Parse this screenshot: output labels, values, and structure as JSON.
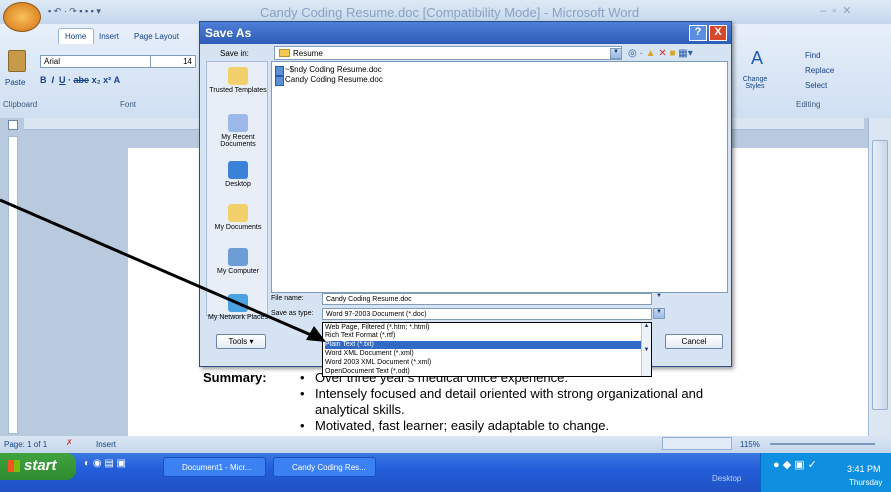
{
  "word": {
    "title": "Candy Coding Resume.doc [Compatibility Mode] - Microsoft Word",
    "tabs": [
      "Home",
      "Insert",
      "Page Layout"
    ],
    "font_name": "Arial",
    "font_size": "14",
    "paste_label": "Paste",
    "clipboard_label": "Clipboard",
    "font_group_label": "Font",
    "change_styles_label": "Change Styles",
    "find_label": "Find",
    "replace_label": "Replace",
    "select_label": "Select",
    "editing_label": "Editing",
    "summary_label": "Summary:",
    "summary_lines": [
      "Over three year's medical office experience.",
      "Intensely focused and detail oriented with strong organizational and",
      "analytical skills.",
      "Motivated, fast learner; easily adaptable to change."
    ],
    "status_page": "Page: 1 of 1",
    "status_insert": "Insert",
    "zoom": "115%"
  },
  "dialog": {
    "title": "Save As",
    "help": "?",
    "close": "X",
    "save_in_label": "Save in:",
    "save_in_value": "Resume",
    "places": [
      "Trusted Templates",
      "My Recent Documents",
      "Desktop",
      "My Documents",
      "My Computer",
      "My Network Places"
    ],
    "files": [
      "~$ndy Coding Resume.doc",
      "Candy Coding Resume.doc"
    ],
    "file_name_label": "File name:",
    "file_name_value": "Candy Coding Resume.doc",
    "save_type_label": "Save as type:",
    "save_type_value": "Word 97-2003 Document (*.doc)",
    "type_options": [
      "Web Page, Filtered (*.htm; *.html)",
      "Rich Text Format (*.rtf)",
      "Plain Text (*.txt)",
      "Word XML Document (*.xml)",
      "Word 2003 XML Document (*.xml)",
      "OpenDocument Text (*.odt)"
    ],
    "selected_option_index": 2,
    "tools_label": "Tools",
    "cancel_label": "Cancel"
  },
  "taskbar": {
    "start": "start",
    "items": [
      "Document1 - Micr...",
      "Candy Coding Res..."
    ],
    "desktop_label": "Desktop",
    "time": "3:41 PM",
    "day": "Thursday"
  }
}
